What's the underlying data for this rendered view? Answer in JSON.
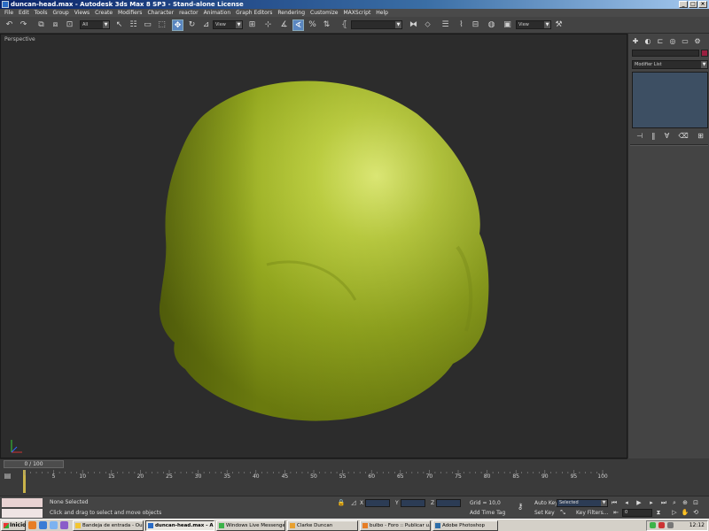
{
  "window": {
    "title": "duncan-head.max - Autodesk 3ds Max 8 SP3 - Stand-alone License",
    "controls": [
      "_",
      "□",
      "×"
    ]
  },
  "menu": [
    "File",
    "Edit",
    "Tools",
    "Group",
    "Views",
    "Create",
    "Modifiers",
    "Character",
    "reactor",
    "Animation",
    "Graph Editors",
    "Rendering",
    "Customize",
    "MAXScript",
    "Help"
  ],
  "toolbar": {
    "selection_filter": "All",
    "ref_coord": "View",
    "named_selection": "",
    "render_view": "View"
  },
  "viewport": {
    "label": "Perspective",
    "object_color": "#9fb32a"
  },
  "command_panel": {
    "object_name": "",
    "object_color": "#9a2040",
    "modifier_list": "Modifier List"
  },
  "timeline": {
    "slider_label": "0 / 100",
    "ticks": [
      "5",
      "10",
      "15",
      "20",
      "25",
      "30",
      "35",
      "40",
      "45",
      "50",
      "55",
      "60",
      "65",
      "70",
      "75",
      "80",
      "85",
      "90",
      "95",
      "100"
    ]
  },
  "status": {
    "selection": "None Selected",
    "prompt": "Click and drag to select and move objects",
    "x_label": "X",
    "x_value": "",
    "y_label": "Y",
    "y_value": "",
    "z_label": "Z",
    "z_value": "",
    "grid": "Grid = 10,0",
    "add_time_tag": "Add Time Tag",
    "auto_key": "Auto Key",
    "set_key": "Set Key",
    "key_mode": "Selected",
    "key_filters": "Key Filters...",
    "frame": "0"
  },
  "taskbar": {
    "start": "Inicio",
    "tasks": [
      {
        "label": "Bandeja de entrada - Ou...",
        "active": false
      },
      {
        "label": "duncan-head.max - A...",
        "active": true
      },
      {
        "label": "Windows Live Messenger",
        "active": false
      },
      {
        "label": "Clarke Duncan",
        "active": false
      },
      {
        "label": "bulbo - Foro :: Publicar u...",
        "active": false
      },
      {
        "label": "Adobe Photoshop",
        "active": false
      }
    ],
    "clock": "12:12"
  }
}
